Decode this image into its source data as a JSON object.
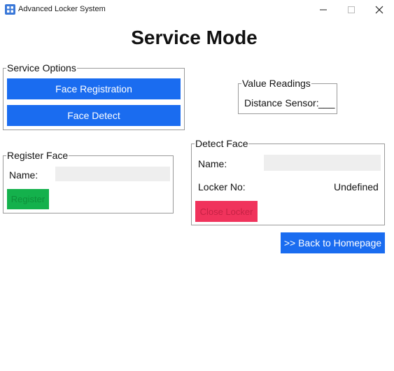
{
  "window": {
    "title": "Advanced Locker System",
    "controls": {
      "minimize": "—",
      "maximize": "☐",
      "close": "✕"
    }
  },
  "heading": "Service Mode",
  "service_options": {
    "legend": "Service Options",
    "face_registration_label": "Face Registration",
    "face_detect_label": "Face Detect"
  },
  "value_readings": {
    "legend": "Value Readings",
    "distance_label": "Distance Sensor:",
    "distance_value": "___"
  },
  "register_face": {
    "legend": "Register Face",
    "name_label": "Name:",
    "name_value": "",
    "register_label": "Register"
  },
  "detect_face": {
    "legend": "Detect Face",
    "name_label": "Name:",
    "name_value": "",
    "locker_label": "Locker No:",
    "locker_value": "Undefined",
    "close_locker_label": "Close Locker"
  },
  "back_button_label": ">> Back to Homepage",
  "colors": {
    "primary_blue": "#1a6cf0",
    "register_green": "#14b14c",
    "close_red": "#f0335c",
    "field_bg": "#eeeeee"
  },
  "icons": {
    "app": "locker-app-icon"
  }
}
